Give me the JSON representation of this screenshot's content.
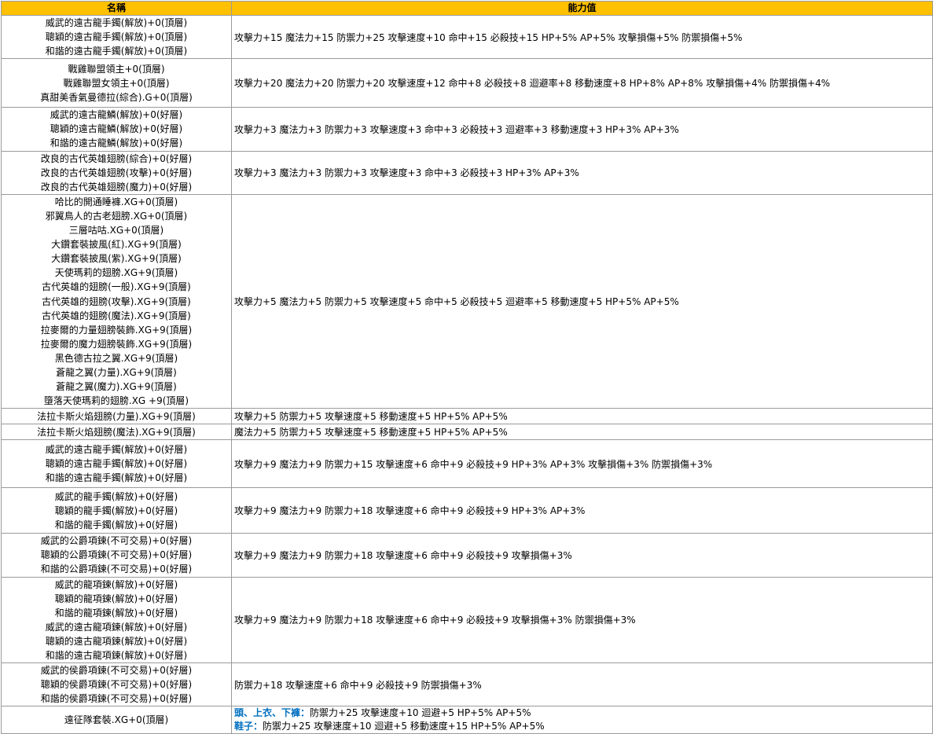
{
  "header": {
    "col_name": "名稱",
    "col_stats": "能力值"
  },
  "rows": [
    {
      "names": [
        "威武的遠古龍手鐲(解放)+0(頂層)",
        "聰穎的遠古龍手鐲(解放)+0(頂層)",
        "和諧的遠古龍手鐲(解放)+0(頂層)"
      ],
      "stats": "攻擊力+15 魔法力+15 防禦力+25 攻擊速度+10 命中+15 必殺技+15 HP+5% AP+5% 攻擊損傷+5% 防禦損傷+5%"
    },
    {
      "names": [
        "戰雞聯盟領主+0(頂層)",
        "戰雞聯盟女領主+0(頂層)",
        "真甜美香氣曼德拉(綜合).G+0(頂層)"
      ],
      "stats": "攻擊力+20 魔法力+20 防禦力+20 攻擊速度+12 命中+8 必殺技+8 迴避率+8 移動速度+8 HP+8% AP+8% 攻擊損傷+4% 防禦損傷+4%"
    },
    {
      "names": [
        "威武的遠古龍鱗(解放)+0(好層)",
        "聰穎的遠古龍鱗(解放)+0(好層)",
        "和諧的遠古龍鱗(解放)+0(好層)"
      ],
      "stats": "攻擊力+3 魔法力+3 防禦力+3 攻擊速度+3 命中+3 必殺技+3 迴避率+3 移動速度+3  HP+3% AP+3%"
    },
    {
      "names": [
        "改良的古代英雄翅膀(綜合)+0(好層)",
        "改良的古代英雄翅膀(攻擊)+0(好層)",
        "改良的古代英雄翅膀(魔力)+0(好層)"
      ],
      "stats": "攻擊力+3 魔法力+3 防禦力+3 攻擊速度+3 命中+3 必殺技+3 HP+3% AP+3%"
    },
    {
      "names": [
        "哈比的開通睡褲.XG+0(頂層)",
        "邪翼鳥人的古老翅膀.XG+0(頂層)",
        "三層咕咕.XG+0(頂層)",
        "大鑽套裝披風(紅).XG+9(頂層)",
        "大鑽套裝披風(紫).XG+9(頂層)",
        "天使瑪莉的翅膀.XG+9(頂層)",
        "古代英雄的翅膀(一般).XG+9(頂層)",
        "古代英雄的翅膀(攻擊).XG+9(頂層)",
        "古代英雄的翅膀(魔法).XG+9(頂層)",
        "拉麥爾的力量翅膀裝飾.XG+9(頂層)",
        "拉麥爾的魔力翅膀裝飾.XG+9(頂層)",
        "黑色德古拉之翼.XG+9(頂層)",
        "蒼龍之翼(力量).XG+9(頂層)",
        "蒼龍之翼(魔力).XG+9(頂層)",
        "墮落天使瑪莉的翅膀.XG +9(頂層)"
      ],
      "stats": "攻擊力+5 魔法力+5 防禦力+5 攻擊速度+5 命中+5 必殺技+5 迴避率+5 移動速度+5  HP+5% AP+5%"
    },
    {
      "names": [
        "法拉卡斯火焰翅膀(力量).XG+9(頂層)"
      ],
      "stats": "攻擊力+5 防禦力+5 攻擊速度+5 移動速度+5 HP+5% AP+5%"
    },
    {
      "names": [
        "法拉卡斯火焰翅膀(魔法).XG+9(頂層)"
      ],
      "stats": "魔法力+5 防禦力+5 攻擊速度+5 移動速度+5 HP+5% AP+5%"
    },
    {
      "names": [
        "威武的遠古龍手鐲(解放)+0(好層)",
        "聰穎的遠古龍手鐲(解放)+0(好層)",
        "和諧的遠古龍手鐲(解放)+0(好層)"
      ],
      "stats": "攻擊力+9 魔法力+9 防禦力+15 攻擊速度+6 命中+9 必殺技+9  HP+3% AP+3% 攻擊損傷+3% 防禦損傷+3%"
    },
    {
      "names": [
        "威武的龍手鐲(解放)+0(好層)",
        "聰穎的龍手鐲(解放)+0(好層)",
        "和諧的龍手鐲(解放)+0(好層)"
      ],
      "stats": "攻擊力+9 魔法力+9 防禦力+18 攻擊速度+6 命中+9 必殺技+9  HP+3% AP+3%"
    },
    {
      "names": [
        "威武的公爵項鍊(不可交易)+0(好層)",
        "聰穎的公爵項鍊(不可交易)+0(好層)",
        "和諧的公爵項鍊(不可交易)+0(好層)"
      ],
      "stats": "攻擊力+9 魔法力+9 防禦力+18 攻擊速度+6 命中+9 必殺技+9 攻擊損傷+3%"
    },
    {
      "names": [
        "威武的龍項鍊(解放)+0(好層)",
        "聰穎的龍項鍊(解放)+0(好層)",
        "和諧的龍項鍊(解放)+0(好層)",
        "威武的遠古龍項鍊(解放)+0(好層)",
        "聰穎的遠古龍項鍊(解放)+0(好層)",
        "和諧的遠古龍項鍊(解放)+0(好層)"
      ],
      "stats": "攻擊力+9 魔法力+9 防禦力+18 攻擊速度+6 命中+9 必殺技+9 攻擊損傷+3% 防禦損傷+3%"
    },
    {
      "names": [
        "威武的侯爵項鍊(不可交易)+0(好層)",
        "聰穎的侯爵項鍊(不可交易)+0(好層)",
        "和諧的侯爵項鍊(不可交易)+0(好層)"
      ],
      "stats": "防禦力+18 攻擊速度+6 命中+9 必殺技+9  防禦損傷+3%"
    }
  ],
  "last_row": {
    "name": "遠征隊套裝.XG+0(頂層)",
    "line1_label": "頭、上衣、下褲：",
    "line1_stats": "防禦力+25 攻擊速度+10 迴避+5 HP+5% AP+5%",
    "line2_label": "鞋子：",
    "line2_stats": "防禦力+25 攻擊速度+10 迴避+5 移動速度+15 HP+5% AP+5%"
  }
}
